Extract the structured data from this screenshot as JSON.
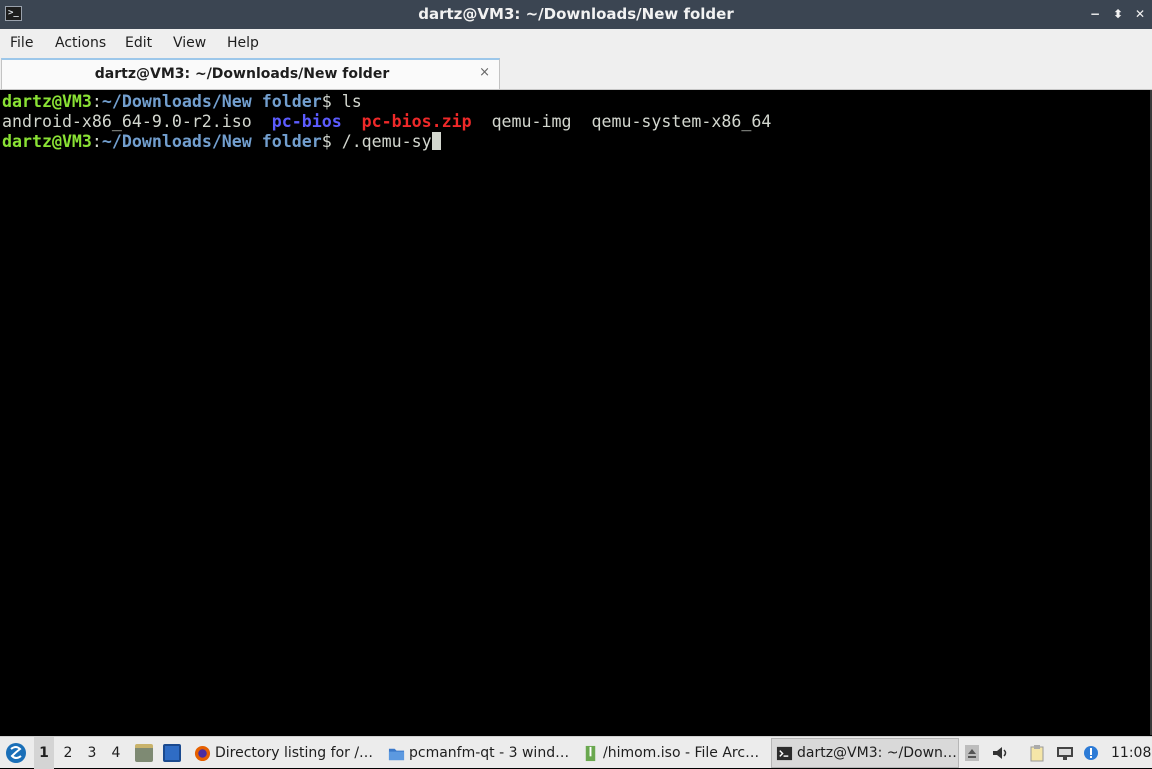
{
  "window": {
    "title": "dartz@VM3: ~/Downloads/New folder",
    "app_icon": ">_",
    "controls": {
      "minimize": "−",
      "maximize": "⬍",
      "close": "✕"
    }
  },
  "menubar": {
    "file": "File",
    "actions": "Actions",
    "edit": "Edit",
    "view": "View",
    "help": "Help"
  },
  "tabs": [
    {
      "label": "dartz@VM3: ~/Downloads/New folder",
      "close": "×"
    }
  ],
  "terminal": {
    "prompt_user": "dartz@VM3",
    "prompt_sep": ":",
    "prompt_path": "~/Downloads/New folder",
    "prompt_dollar": "$ ",
    "command1": "ls",
    "ls_output": [
      {
        "name": "android-x86_64-9.0-r2.iso",
        "kind": "file"
      },
      {
        "name": "pc-bios",
        "kind": "dir"
      },
      {
        "name": "pc-bios.zip",
        "kind": "archive"
      },
      {
        "name": "qemu-img",
        "kind": "file"
      },
      {
        "name": "qemu-system-x86_64",
        "kind": "file"
      }
    ],
    "command2": "/.qemu-sy",
    "colors": {
      "user": "#8ae234",
      "dir": "#5c5cff",
      "archive": "#ef2929",
      "text": "#d3d7cf"
    }
  },
  "taskbar": {
    "workspaces": [
      "1",
      "2",
      "3",
      "4"
    ],
    "active_workspace": "1",
    "launchers": [
      "file-manager-icon",
      "show-desktop-icon"
    ],
    "tasks": [
      {
        "label": "Directory listing for /…",
        "icon": "firefox-icon"
      },
      {
        "label": "pcmanfm-qt - 3 wind…",
        "icon": "folder-icon"
      },
      {
        "label": "/himom.iso - File Arc…",
        "icon": "archive-icon"
      },
      {
        "label": "dartz@VM3: ~/Down…",
        "icon": "terminal-icon",
        "active": true
      }
    ],
    "tray": [
      "eject-icon",
      "volume-icon",
      "clipboard-icon",
      "network-icon",
      "update-notifier-icon"
    ],
    "clock": "11:08"
  }
}
